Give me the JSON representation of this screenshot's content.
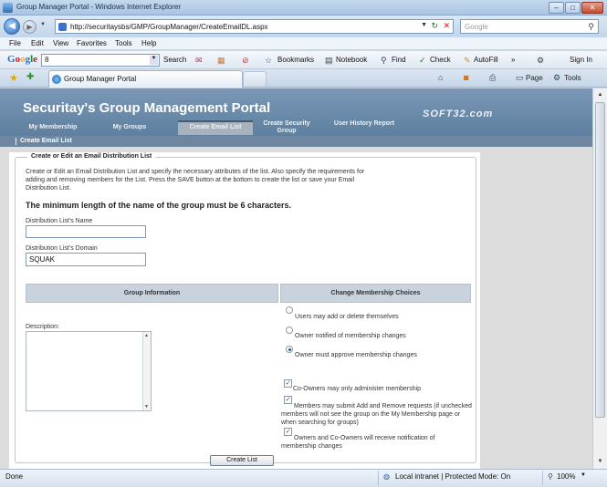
{
  "window": {
    "title": "Group Manager Portal - Windows Internet Explorer",
    "min": "–",
    "max": "□",
    "close": "✕"
  },
  "address": {
    "url": "http://securitaysbs/GMP/GroupManager/CreateEmailDL.aspx",
    "search_placeholder": "Google"
  },
  "menu": [
    "File",
    "Edit",
    "View",
    "Favorites",
    "Tools",
    "Help"
  ],
  "google_toolbar": {
    "logo": "Google",
    "box_value": "8",
    "search": "Search",
    "bookmarks": "Bookmarks",
    "notebook": "Notebook",
    "find": "Find",
    "check": "Check",
    "autofill": "AutoFill",
    "more": "»",
    "signin": "Sign In"
  },
  "tabs": {
    "active": "Group Manager Portal",
    "page_menu": "Page",
    "tools_menu": "Tools"
  },
  "page": {
    "title": "Securitay's Group Management Portal",
    "watermark": "SOFT32.com",
    "nav": [
      "My Membership",
      "My Groups",
      "Create Email List",
      "Create Security Group",
      "User History Report"
    ],
    "breadcrumb": "Create Email List",
    "legend": "Create or Edit an Email Distribution List",
    "intro": "Create or Edit an Email Distribution List and specify the necessary attributes of the list. Also specify the requirements for adding and removing members for the List. Press the SAVE button at the bottom to create the list or save your Email Distribution List.",
    "min_length_note": "The minimum length of the name of the group must be 6 characters.",
    "name_label": "Distribution List's Name",
    "name_value": "",
    "domain_label": "Distribution List's Domain",
    "domain_value": "SQUAK",
    "group_info_header": "Group Information",
    "membership_header": "Change Membership Choices",
    "description_label": "Description:",
    "radio_options": [
      {
        "label": "Users may add or delete themselves",
        "selected": false
      },
      {
        "label": "Owner notified of membership changes",
        "selected": false
      },
      {
        "label": "Owner must approve membership changes",
        "selected": true
      }
    ],
    "checkbox_options": [
      {
        "label": "Co-Owners may only administer membership",
        "checked": true
      },
      {
        "label": "Members may submit Add and Remove requests (if unchecked members will not see the group on the My Membership page or when searching for groups)",
        "checked": true
      },
      {
        "label": "Owners and Co-Owners will receive notification of membership changes",
        "checked": true
      }
    ],
    "create_button": "Create List"
  },
  "status": {
    "text": "Done",
    "zone": "Local intranet | Protected Mode: On",
    "zoom": "100%"
  },
  "colors": {
    "header": "#6f8cab",
    "nav_active": "#a7b2bd",
    "section_header": "#c9d3de"
  }
}
